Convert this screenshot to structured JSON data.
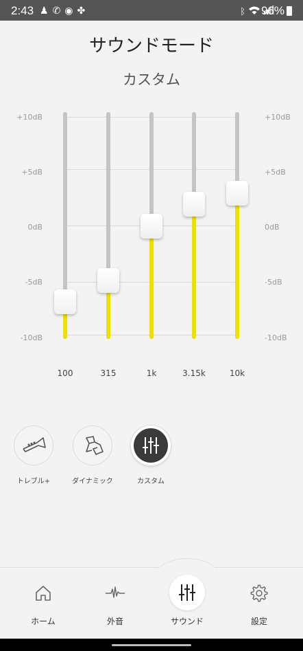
{
  "status_bar": {
    "time": "2:43",
    "battery_percent": "96%",
    "left_icons": [
      "notification-icon",
      "missed-call-icon",
      "media-icon",
      "fan-icon"
    ],
    "right_icons": [
      "bluetooth-icon",
      "wifi-icon",
      "signal-icon"
    ]
  },
  "header": {
    "title": "サウンドモード",
    "subtitle": "カスタム"
  },
  "eq": {
    "db_labels": [
      "+10dB",
      "+5dB",
      "0dB",
      "-5dB",
      "-10dB"
    ],
    "bands": [
      {
        "freq": "100",
        "level_db": -7
      },
      {
        "freq": "315",
        "level_db": -5
      },
      {
        "freq": "1k",
        "level_db": 0
      },
      {
        "freq": "3.15k",
        "level_db": 2
      },
      {
        "freq": "10k",
        "level_db": 3
      }
    ],
    "accent_color": "#f0e000"
  },
  "modes": [
    {
      "label": "トレブル+",
      "icon": "trumpet-icon",
      "selected": false
    },
    {
      "label": "ダイナミック",
      "icon": "guitarist-icon",
      "selected": false
    },
    {
      "label": "カスタム",
      "icon": "equalizer-icon",
      "selected": true
    }
  ],
  "bottom_nav": [
    {
      "label": "ホーム",
      "icon": "home-icon",
      "active": false
    },
    {
      "label": "外音",
      "icon": "waveform-icon",
      "active": false
    },
    {
      "label": "サウンド",
      "icon": "equalizer-icon",
      "active": true
    },
    {
      "label": "設定",
      "icon": "gear-icon",
      "active": false
    }
  ]
}
